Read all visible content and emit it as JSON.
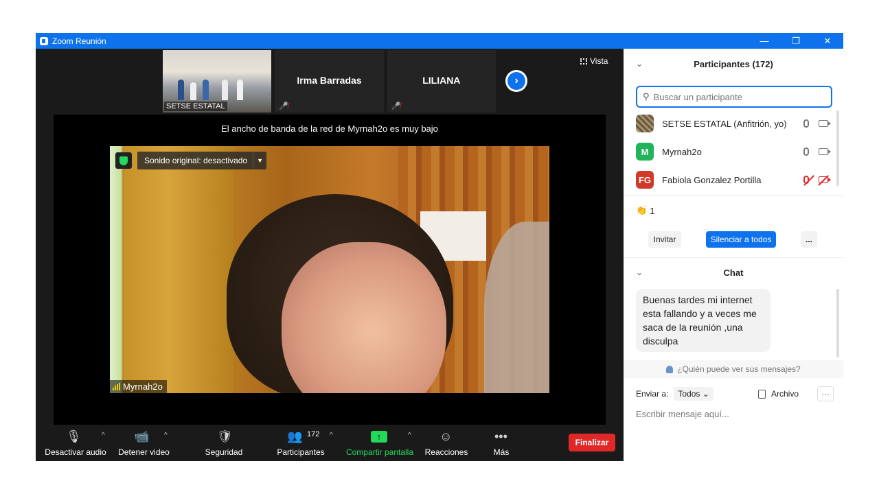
{
  "window": {
    "title": "Zoom Reunión",
    "controls": {
      "minimize": "—",
      "restore": "❐",
      "close": "✕"
    }
  },
  "colors": {
    "accent": "#0e72ed",
    "danger": "#e02828",
    "success": "#23d959"
  },
  "gallery": {
    "tiles": [
      {
        "label": "SETSE ESTATAL",
        "type": "video"
      },
      {
        "label": "Irma Barradas",
        "type": "name",
        "muted": true
      },
      {
        "label": "LILIANA",
        "type": "name",
        "muted": true
      }
    ],
    "next_icon": "›",
    "view_label": "Vista"
  },
  "stage": {
    "bandwidth_message": "El ancho de banda de la red de Myrnah2o es muy bajo",
    "original_sound": "Sonido original: desactivado",
    "speaker_name": "Myrnah2o"
  },
  "toolbar": {
    "audio": "Desactivar audio",
    "video": "Detener video",
    "security": "Seguridad",
    "participants": "Participantes",
    "participants_count": "172",
    "share": "Compartir pantalla",
    "reactions": "Reacciones",
    "more": "Más",
    "end": "Finalizar"
  },
  "participants_panel": {
    "title": "Participantes (172)",
    "search_placeholder": "Buscar un participante",
    "list": [
      {
        "name": "SETSE ESTATAL (Anfitrión, yo)",
        "avatar": "",
        "avatar_color": "#6a5a40",
        "muted": false
      },
      {
        "name": "Myrnah2o",
        "avatar": "M",
        "avatar_color": "#23b35a",
        "muted": false
      },
      {
        "name": "Fabiola Gonzalez Portilla",
        "avatar": "FG",
        "avatar_color": "#d03a2a",
        "muted": true
      }
    ],
    "reaction_count": "1",
    "invite": "Invitar",
    "mute_all": "Silenciar a todos",
    "more": "..."
  },
  "chat": {
    "title": "Chat",
    "message": "Buenas tardes mi internet esta fallando y a veces me saca de la reunión ,una disculpa",
    "who_can_see": "¿Quién puede ver sus mensajes?",
    "send_to_label": "Enviar a:",
    "send_to_value": "Todos",
    "file": "Archivo",
    "more": "···",
    "input_placeholder": "Escribir mensaje aquí..."
  }
}
